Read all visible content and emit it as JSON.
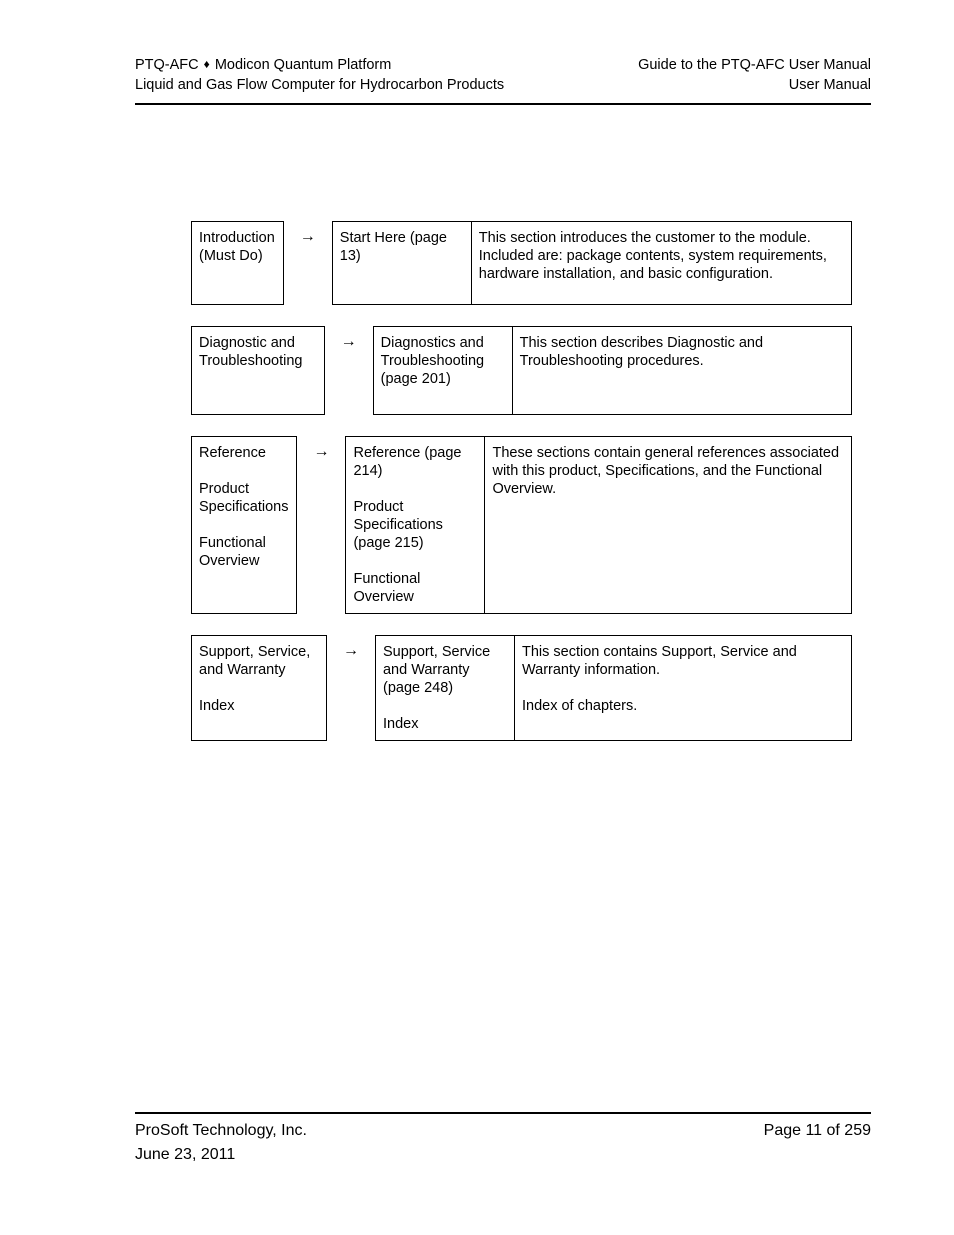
{
  "header": {
    "left_line1_prefix": "PTQ-AFC",
    "separator_glyph": "♦",
    "left_line1_suffix": "Modicon Quantum Platform",
    "left_line2": "Liquid and Gas Flow Computer for Hydrocarbon Products",
    "right_line1": "Guide to the PTQ-AFC User Manual",
    "right_line2": "User Manual"
  },
  "guide_table": {
    "arrow_glyph": "→",
    "rows": [
      {
        "left_lines": [
          "Introduction",
          "(Must Do)"
        ],
        "middle_blocks": [
          "Start Here (page 13)"
        ],
        "right_blocks": [
          "This section introduces the customer to the module. Included are: package contents, system requirements, hardware installation, and basic configuration."
        ]
      },
      {
        "left_lines": [
          "Diagnostic and",
          "Troubleshooting"
        ],
        "middle_blocks": [
          "Diagnostics and Troubleshooting (page 201)"
        ],
        "right_blocks": [
          "This section describes Diagnostic and Troubleshooting procedures."
        ]
      },
      {
        "left_lines": [
          "Reference",
          "Product Specifications",
          "Functional Overview"
        ],
        "middle_blocks": [
          "Reference (page 214)",
          "Product Specifications (page 215)",
          "Functional Overview"
        ],
        "right_blocks": [
          "These sections contain general references associated with this product, Specifications, and the Functional Overview."
        ]
      },
      {
        "left_lines": [
          "Support, Service, and Warranty",
          "Index"
        ],
        "middle_blocks": [
          "Support, Service and Warranty (page 248)",
          "Index"
        ],
        "right_blocks": [
          "This section contains Support, Service and Warranty information.",
          "Index of chapters."
        ]
      }
    ]
  },
  "footer": {
    "company": "ProSoft Technology, Inc.",
    "date": "June 23, 2011",
    "page_number": "Page 11 of 259"
  },
  "colors": {
    "text": "#000000",
    "rule": "#000000",
    "background": "#ffffff"
  }
}
